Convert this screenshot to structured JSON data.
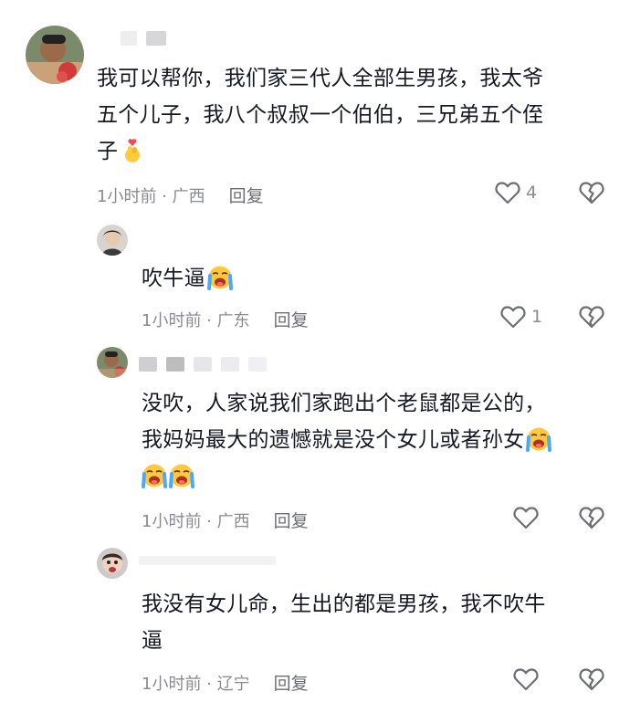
{
  "comments": [
    {
      "text": "我可以帮你，我们家三代人全部生男孩，我太爷五个儿子，我八个叔叔一个伯伯，三兄弟五个侄子",
      "lines": [
        "我可以帮你，我们家三代人全部生男孩，我太爷",
        "五个儿子，我八个叔叔一个伯伯，三兄弟五个侄",
        "子"
      ],
      "emoji": "finger-heart-emoji",
      "time": "1小时前 · 广西",
      "reply": "回复",
      "likes": "4"
    },
    {
      "text": "吹牛逼",
      "lines": [
        "吹牛逼"
      ],
      "emoji": "crying-face-emoji",
      "time": "1小时前 · 广东",
      "reply": "回复",
      "likes": "1"
    },
    {
      "text": "没吹，人家说我们家跑出个老鼠都是公的，我妈妈最大的遗憾就是没个女儿或者孙女",
      "lines": [
        "没吹，人家说我们家跑出个老鼠都是公的，",
        "我妈妈最大的遗憾就是没个女儿或者孙女"
      ],
      "emoji": "crying-face-emoji",
      "time": "1小时前 · 广西",
      "reply": "回复",
      "likes": ""
    },
    {
      "text": "我没有女儿命，生出的都是男孩，我不吹牛逼",
      "lines": [
        "我没有女儿命，生出的都是男孩，我不吹牛",
        "逼"
      ],
      "emoji": "",
      "time": "1小时前 · 辽宁",
      "reply": "回复",
      "likes": ""
    }
  ],
  "colors": {
    "text": "#161823",
    "meta": "#8a8b91",
    "icon": "#6d6e74"
  },
  "icons": [
    "heart-outline-icon",
    "broken-heart-icon"
  ]
}
